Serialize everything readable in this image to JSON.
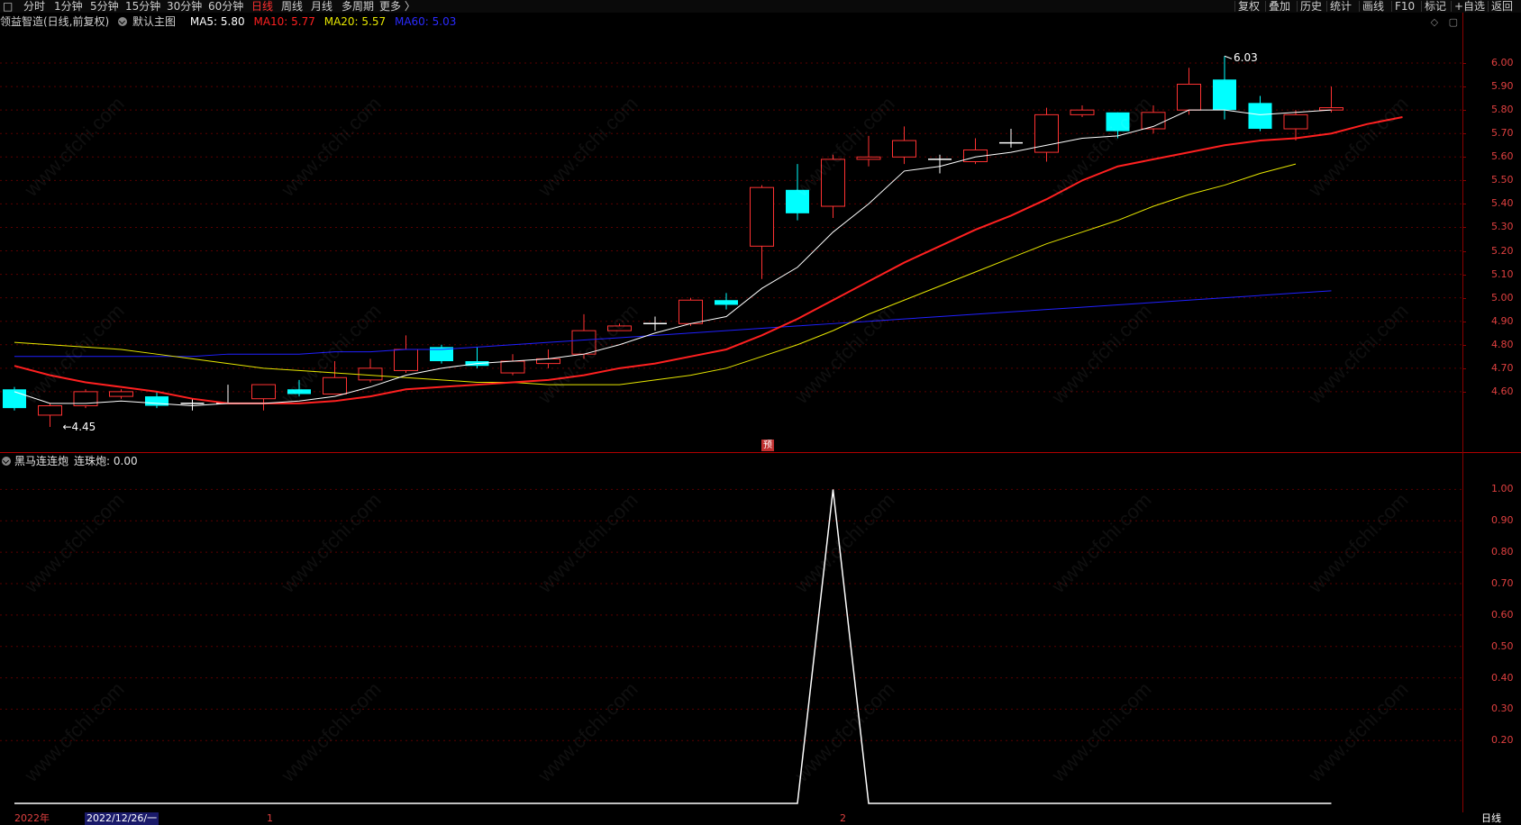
{
  "toolbar": {
    "left": [
      "分时",
      "1分钟",
      "5分钟",
      "15分钟",
      "30分钟",
      "60分钟",
      "日线",
      "周线",
      "月线",
      "多周期",
      "更多 〉"
    ],
    "active": "日线",
    "right": [
      "复权",
      "叠加",
      "历史",
      "统计",
      "画线",
      "F10",
      "标记",
      "+自选",
      "返回"
    ]
  },
  "main_info": {
    "stock": "领益智造(日线,前复权)",
    "template": "默认主图",
    "ma5_label": "MA5: 5.80",
    "ma10_label": "MA10: 5.77",
    "ma20_label": "MA20: 5.57",
    "ma60_label": "MA60: 5.03"
  },
  "sub_info": {
    "indicator": "黑马连连炮",
    "value_label": "连珠炮: 0.00"
  },
  "main_axis_labels": [
    "6.00",
    "5.90",
    "5.80",
    "5.70",
    "5.60",
    "5.50",
    "5.40",
    "5.30",
    "5.20",
    "5.10",
    "5.00",
    "4.90",
    "4.80",
    "4.70",
    "4.60"
  ],
  "sub_axis_labels": [
    "1.00",
    "0.90",
    "0.80",
    "0.70",
    "0.60",
    "0.50",
    "0.40",
    "0.30",
    "0.20"
  ],
  "annotations": {
    "high": "6.03",
    "low": "←4.45",
    "pre_badge": "预"
  },
  "bottom": {
    "year": "2022年",
    "date": "2022/12/26/一",
    "mark1": "1",
    "mark2": "2",
    "period": "日线"
  },
  "watermark_text": "www.cfchi.com",
  "colors": {
    "up": "#ff3232",
    "down": "#00ffff",
    "ma5": "#ffffff",
    "ma10": "#ff2020",
    "ma20": "#e6e600",
    "ma60": "#2020ff"
  },
  "chart_data": {
    "type": "candlestick",
    "ylim": [
      4.4,
      6.1
    ],
    "candles": [
      {
        "o": 4.61,
        "c": 4.53,
        "h": 4.62,
        "l": 4.52
      },
      {
        "o": 4.5,
        "c": 4.54,
        "h": 4.55,
        "l": 4.45
      },
      {
        "o": 4.54,
        "c": 4.6,
        "h": 4.61,
        "l": 4.53
      },
      {
        "o": 4.58,
        "c": 4.6,
        "h": 4.61,
        "l": 4.57
      },
      {
        "o": 4.58,
        "c": 4.54,
        "h": 4.6,
        "l": 4.53
      },
      {
        "o": 4.55,
        "c": 4.55,
        "h": 4.57,
        "l": 4.52
      },
      {
        "o": 4.55,
        "c": 4.55,
        "h": 4.63,
        "l": 4.55
      },
      {
        "o": 4.57,
        "c": 4.63,
        "h": 4.63,
        "l": 4.52
      },
      {
        "o": 4.61,
        "c": 4.59,
        "h": 4.65,
        "l": 4.58
      },
      {
        "o": 4.59,
        "c": 4.66,
        "h": 4.73,
        "l": 4.59
      },
      {
        "o": 4.65,
        "c": 4.7,
        "h": 4.74,
        "l": 4.64
      },
      {
        "o": 4.69,
        "c": 4.78,
        "h": 4.84,
        "l": 4.68
      },
      {
        "o": 4.79,
        "c": 4.73,
        "h": 4.8,
        "l": 4.72
      },
      {
        "o": 4.73,
        "c": 4.71,
        "h": 4.79,
        "l": 4.7
      },
      {
        "o": 4.68,
        "c": 4.73,
        "h": 4.76,
        "l": 4.67
      },
      {
        "o": 4.72,
        "c": 4.74,
        "h": 4.78,
        "l": 4.7
      },
      {
        "o": 4.76,
        "c": 4.86,
        "h": 4.93,
        "l": 4.74
      },
      {
        "o": 4.86,
        "c": 4.88,
        "h": 4.89,
        "l": 4.86
      },
      {
        "o": 4.89,
        "c": 4.89,
        "h": 4.92,
        "l": 4.86
      },
      {
        "o": 4.89,
        "c": 4.99,
        "h": 5.0,
        "l": 4.88
      },
      {
        "o": 4.99,
        "c": 4.97,
        "h": 5.02,
        "l": 4.95
      },
      {
        "o": 5.22,
        "c": 5.47,
        "h": 5.48,
        "l": 5.08
      },
      {
        "o": 5.46,
        "c": 5.36,
        "h": 5.57,
        "l": 5.33
      },
      {
        "o": 5.39,
        "c": 5.59,
        "h": 5.61,
        "l": 5.34
      },
      {
        "o": 5.59,
        "c": 5.6,
        "h": 5.69,
        "l": 5.56
      },
      {
        "o": 5.6,
        "c": 5.67,
        "h": 5.73,
        "l": 5.57
      },
      {
        "o": 5.59,
        "c": 5.59,
        "h": 5.61,
        "l": 5.53
      },
      {
        "o": 5.58,
        "c": 5.63,
        "h": 5.68,
        "l": 5.57
      },
      {
        "o": 5.66,
        "c": 5.66,
        "h": 5.72,
        "l": 5.64
      },
      {
        "o": 5.62,
        "c": 5.78,
        "h": 5.81,
        "l": 5.58
      },
      {
        "o": 5.78,
        "c": 5.8,
        "h": 5.82,
        "l": 5.77
      },
      {
        "o": 5.79,
        "c": 5.71,
        "h": 5.79,
        "l": 5.68
      },
      {
        "o": 5.72,
        "c": 5.79,
        "h": 5.82,
        "l": 5.7
      },
      {
        "o": 5.8,
        "c": 5.91,
        "h": 5.98,
        "l": 5.78
      },
      {
        "o": 5.93,
        "c": 5.8,
        "h": 6.03,
        "l": 5.76
      },
      {
        "o": 5.83,
        "c": 5.72,
        "h": 5.86,
        "l": 5.71
      },
      {
        "o": 5.72,
        "c": 5.78,
        "h": 5.8,
        "l": 5.67
      },
      {
        "o": 5.8,
        "c": 5.81,
        "h": 5.9,
        "l": 5.79
      }
    ],
    "ma5": [
      4.6,
      4.55,
      4.55,
      4.56,
      4.55,
      4.54,
      4.55,
      4.55,
      4.56,
      4.58,
      4.62,
      4.67,
      4.7,
      4.72,
      4.73,
      4.74,
      4.76,
      4.8,
      4.85,
      4.89,
      4.92,
      5.04,
      5.13,
      5.28,
      5.4,
      5.54,
      5.56,
      5.6,
      5.62,
      5.65,
      5.68,
      5.69,
      5.73,
      5.8,
      5.8,
      5.78,
      5.79,
      5.8
    ],
    "ma10": [
      4.71,
      4.67,
      4.64,
      4.62,
      4.6,
      4.57,
      4.55,
      4.55,
      4.55,
      4.56,
      4.58,
      4.61,
      4.62,
      4.63,
      4.64,
      4.65,
      4.67,
      4.7,
      4.72,
      4.75,
      4.78,
      4.84,
      4.91,
      4.99,
      5.07,
      5.15,
      5.22,
      5.29,
      5.35,
      5.42,
      5.5,
      5.56,
      5.59,
      5.62,
      5.65,
      5.67,
      5.68,
      5.7,
      5.74,
      5.77
    ],
    "ma20": [
      4.81,
      4.8,
      4.79,
      4.78,
      4.76,
      4.74,
      4.72,
      4.7,
      4.69,
      4.68,
      4.67,
      4.66,
      4.65,
      4.64,
      4.64,
      4.63,
      4.63,
      4.63,
      4.65,
      4.67,
      4.7,
      4.75,
      4.8,
      4.86,
      4.93,
      4.99,
      5.05,
      5.11,
      5.17,
      5.23,
      5.28,
      5.33,
      5.39,
      5.44,
      5.48,
      5.53,
      5.57
    ],
    "ma60": [
      4.75,
      4.75,
      4.75,
      4.75,
      4.75,
      4.75,
      4.76,
      4.76,
      4.76,
      4.77,
      4.77,
      4.78,
      4.78,
      4.79,
      4.8,
      4.81,
      4.82,
      4.83,
      4.84,
      4.85,
      4.86,
      4.87,
      4.88,
      4.89,
      4.9,
      4.91,
      4.92,
      4.93,
      4.94,
      4.95,
      4.96,
      4.97,
      4.98,
      4.99,
      5.0,
      5.01,
      5.02,
      5.03
    ],
    "sub_series": [
      0,
      0,
      0,
      0,
      0,
      0,
      0,
      0,
      0,
      0,
      0,
      0,
      0,
      0,
      0,
      0,
      0,
      0,
      0,
      0,
      0,
      0,
      0,
      1,
      0,
      0,
      0,
      0,
      0,
      0,
      0,
      0,
      0,
      0,
      0,
      0,
      0,
      0
    ],
    "sub_ylim": [
      0,
      1.05
    ]
  }
}
